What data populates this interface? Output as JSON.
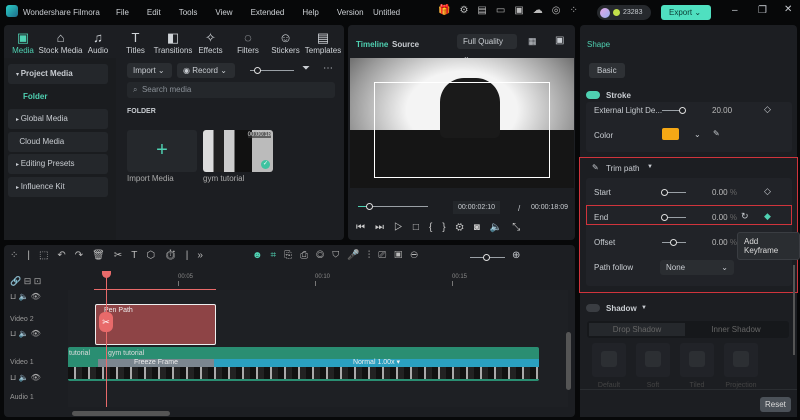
{
  "app": {
    "name": "Wondershare Filmora",
    "menu": [
      "File",
      "Edit",
      "Tools",
      "View",
      "Extended",
      "Help",
      "Version"
    ],
    "doc_title": "Untitled",
    "credits": "23283",
    "export_label": "Export"
  },
  "tabs": [
    {
      "label": "Media",
      "icon": "media-icon"
    },
    {
      "label": "Stock Media",
      "icon": "stock-icon"
    },
    {
      "label": "Audio",
      "icon": "audio-icon"
    },
    {
      "label": "Titles",
      "icon": "titles-icon"
    },
    {
      "label": "Transitions",
      "icon": "transitions-icon"
    },
    {
      "label": "Effects",
      "icon": "effects-icon"
    },
    {
      "label": "Filters",
      "icon": "filters-icon"
    },
    {
      "label": "Stickers",
      "icon": "stickers-icon"
    },
    {
      "label": "Templates",
      "icon": "templates-icon"
    }
  ],
  "sidebar": {
    "items": [
      "Project Media",
      "Folder",
      "Global Media",
      "Cloud Media",
      "Editing Presets",
      "Influence Kit"
    ]
  },
  "media": {
    "import": "Import",
    "record": "Record",
    "search_placeholder": "Search media",
    "folder_heading": "FOLDER",
    "import_media": "Import Media",
    "clip_name": "gym tutorial",
    "clip_duration": "00:00:18"
  },
  "preview": {
    "tab_timeline": "Timeline",
    "tab_source": "Source",
    "quality": "Full Quality",
    "current_time": "00:00:02:10",
    "separator": "/",
    "total_time": "00:00:18:09",
    "progress": 0.13
  },
  "props": {
    "title": "Shape",
    "tab_basic": "Basic",
    "stroke": "Stroke",
    "external_light": "External Light De...",
    "external_light_value": "20.00",
    "color_label": "Color",
    "stroke_color": "#f5a815",
    "trim_path": "Trim path",
    "start": "Start",
    "start_value": "0.00",
    "end": "End",
    "end_value": "0.00",
    "offset": "Offset",
    "offset_value": "0.00",
    "percent": "%",
    "path_follow": "Path follow",
    "path_follow_value": "None",
    "tooltip": "Add Keyframe",
    "shadow": "Shadow",
    "drop_shadow": "Drop Shadow",
    "inner_shadow": "Inner Shadow",
    "presets": [
      "Default",
      "Soft",
      "Tiled",
      "Projection"
    ],
    "reset": "Reset"
  },
  "timeline": {
    "ticks": [
      "00:05",
      "00:10",
      "00:15"
    ],
    "tracks": [
      "Video 2",
      "Video 1",
      "Audio 1"
    ],
    "pen_clip": "Pen Path",
    "video_clip": "gym tutorial",
    "video_clip_prev": "tutorial",
    "freeze": "Freeze Frame",
    "speed": "Normal 1.00x"
  },
  "colors": {
    "accent": "#4fd1b2",
    "highlight": "#d0343c",
    "pen_clip": "#8e4446"
  }
}
